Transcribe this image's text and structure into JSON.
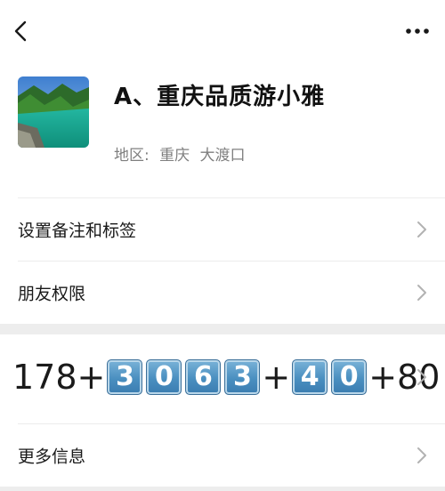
{
  "header": {
    "back_icon": "chevron-left-icon",
    "more_icon": "more-dots-icon"
  },
  "profile": {
    "nickname": "A、重庆品质游小雅",
    "region_label": "地区:",
    "region_values": [
      "重庆",
      "大渡口"
    ],
    "avatar": "landscape-avatar"
  },
  "menu": {
    "remark_tags": "设置备注和标签",
    "friend_permissions": "朋友权限",
    "more_info": "更多信息"
  },
  "phone": {
    "prefix": "178+",
    "keycap_group_1": [
      "3",
      "0",
      "6",
      "3"
    ],
    "mid": "+",
    "keycap_group_2": [
      "4",
      "0"
    ],
    "suffix": "+80"
  },
  "colors": {
    "background": "#ffffff",
    "section_gap": "#ededed",
    "secondary_text": "#7f7f7f",
    "keycap_blue": "#4a8fc0"
  }
}
